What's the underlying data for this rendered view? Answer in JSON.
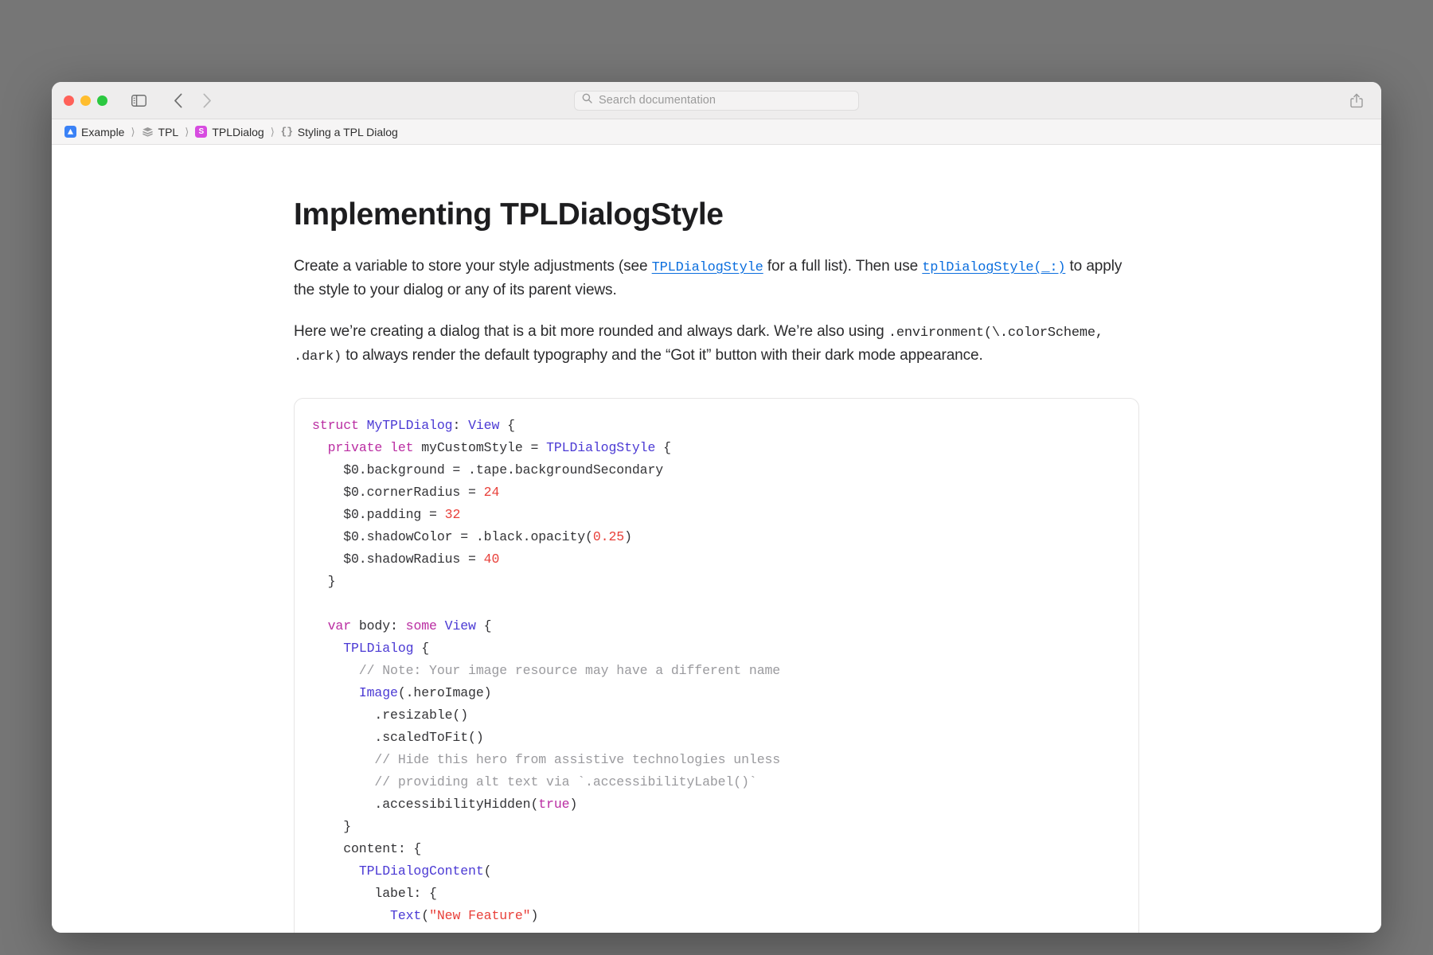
{
  "window": {
    "traffic_lights": [
      "close",
      "minimize",
      "zoom"
    ],
    "toolbar": {
      "sidebar_toggle_label": "Toggle Sidebar",
      "back_label": "Back",
      "forward_label": "Forward",
      "share_label": "Share"
    },
    "search": {
      "placeholder": "Search documentation",
      "value": ""
    }
  },
  "breadcrumb": [
    {
      "icon": "app-icon",
      "label": "Example"
    },
    {
      "icon": "framework-stack-icon",
      "label": "TPL"
    },
    {
      "icon": "struct-symbol-icon",
      "label": "TPLDialog"
    },
    {
      "icon": "braces-icon",
      "label": "Styling a TPL Dialog"
    }
  ],
  "article": {
    "title": "Implementing TPLDialogStyle",
    "paragraph1": {
      "part1": "Create a variable to store your style adjustments (see ",
      "link1": "TPLDialogStyle",
      "part2": " for a full list). Then use ",
      "link2": "tplDialogStyle(_:)",
      "part3": " to apply the style to your dialog or any of its parent views."
    },
    "paragraph2": {
      "part1": "Here we’re creating a dialog that is a bit more rounded and always dark. We’re also using ",
      "code1": ".environment(\\.colorScheme, .dark)",
      "part2": " to always render the default typography and the “Got it” button with their dark mode appearance."
    }
  },
  "code_block": {
    "language": "swift",
    "lines": [
      [
        {
          "t": "struct ",
          "c": "k"
        },
        {
          "t": "MyTPLDialog",
          "c": "t"
        },
        {
          "t": ": ",
          "c": "pl"
        },
        {
          "t": "View",
          "c": "t"
        },
        {
          "t": " {",
          "c": "pl"
        }
      ],
      [
        {
          "t": "  ",
          "c": "pl"
        },
        {
          "t": "private let ",
          "c": "k"
        },
        {
          "t": "myCustomStyle = ",
          "c": "pl"
        },
        {
          "t": "TPLDialogStyle",
          "c": "t"
        },
        {
          "t": " {",
          "c": "pl"
        }
      ],
      [
        {
          "t": "    $0.background = .tape.backgroundSecondary",
          "c": "pl"
        }
      ],
      [
        {
          "t": "    $0.cornerRadius = ",
          "c": "pl"
        },
        {
          "t": "24",
          "c": "n"
        }
      ],
      [
        {
          "t": "    $0.padding = ",
          "c": "pl"
        },
        {
          "t": "32",
          "c": "n"
        }
      ],
      [
        {
          "t": "    $0.shadowColor = .black.opacity(",
          "c": "pl"
        },
        {
          "t": "0.25",
          "c": "n"
        },
        {
          "t": ")",
          "c": "pl"
        }
      ],
      [
        {
          "t": "    $0.shadowRadius = ",
          "c": "pl"
        },
        {
          "t": "40",
          "c": "n"
        }
      ],
      [
        {
          "t": "  }",
          "c": "pl"
        }
      ],
      [
        {
          "t": "",
          "c": "pl"
        }
      ],
      [
        {
          "t": "  ",
          "c": "pl"
        },
        {
          "t": "var ",
          "c": "k"
        },
        {
          "t": "body: ",
          "c": "pl"
        },
        {
          "t": "some ",
          "c": "k"
        },
        {
          "t": "View",
          "c": "t"
        },
        {
          "t": " {",
          "c": "pl"
        }
      ],
      [
        {
          "t": "    ",
          "c": "pl"
        },
        {
          "t": "TPLDialog",
          "c": "t"
        },
        {
          "t": " {",
          "c": "pl"
        }
      ],
      [
        {
          "t": "      // Note: Your image resource may have a different name",
          "c": "c"
        }
      ],
      [
        {
          "t": "      ",
          "c": "pl"
        },
        {
          "t": "Image",
          "c": "t"
        },
        {
          "t": "(.heroImage)",
          "c": "pl"
        }
      ],
      [
        {
          "t": "        .resizable()",
          "c": "pl"
        }
      ],
      [
        {
          "t": "        .scaledToFit()",
          "c": "pl"
        }
      ],
      [
        {
          "t": "        // Hide this hero from assistive technologies unless",
          "c": "c"
        }
      ],
      [
        {
          "t": "        // providing alt text via `.accessibilityLabel()`",
          "c": "c"
        }
      ],
      [
        {
          "t": "        .accessibilityHidden(",
          "c": "pl"
        },
        {
          "t": "true",
          "c": "k"
        },
        {
          "t": ")",
          "c": "pl"
        }
      ],
      [
        {
          "t": "    }",
          "c": "pl"
        }
      ],
      [
        {
          "t": "    content: {",
          "c": "pl"
        }
      ],
      [
        {
          "t": "      ",
          "c": "pl"
        },
        {
          "t": "TPLDialogContent",
          "c": "t"
        },
        {
          "t": "(",
          "c": "pl"
        }
      ],
      [
        {
          "t": "        label: {",
          "c": "pl"
        }
      ],
      [
        {
          "t": "          ",
          "c": "pl"
        },
        {
          "t": "Text",
          "c": "t"
        },
        {
          "t": "(",
          "c": "pl"
        },
        {
          "t": "\"New Feature\"",
          "c": "s"
        },
        {
          "t": ")",
          "c": "pl"
        }
      ]
    ]
  }
}
